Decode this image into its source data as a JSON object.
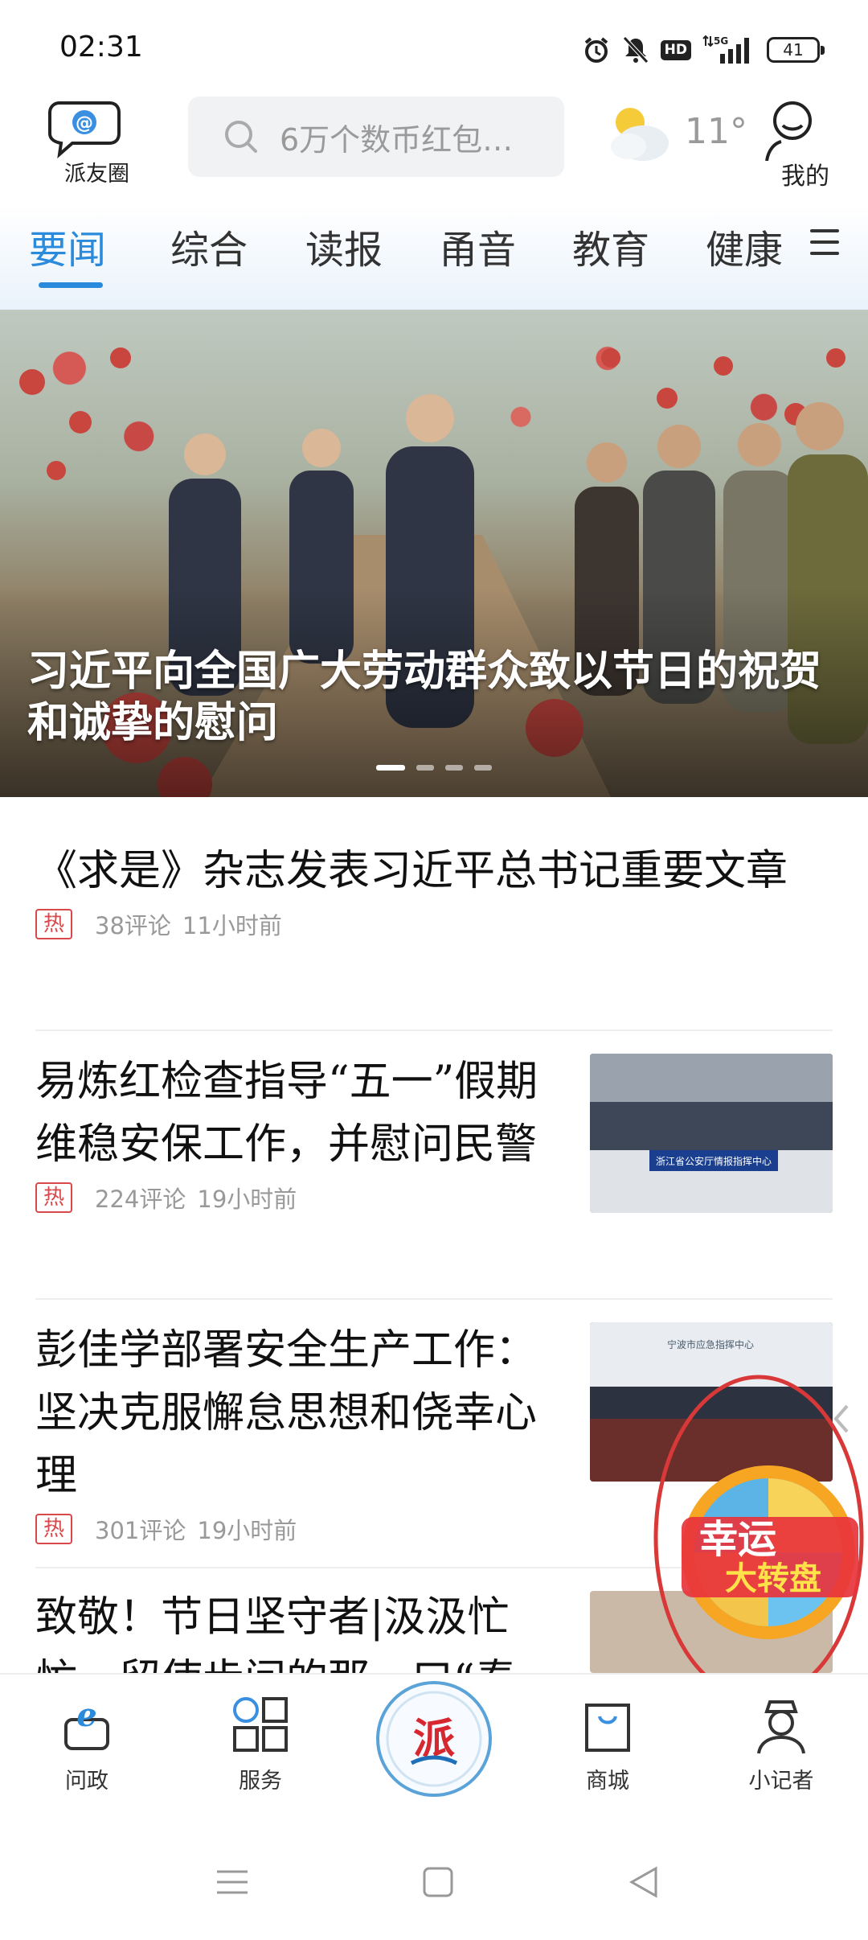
{
  "status_bar": {
    "time": "02:31",
    "hd": "HD",
    "network": "5G",
    "battery": "41"
  },
  "header": {
    "paiyouquan_label": "派友圈",
    "search_placeholder": "6万个数币红包…",
    "temperature": "11°",
    "mine_label": "我的"
  },
  "tabs": [
    {
      "label": "要闻",
      "active": true
    },
    {
      "label": "综合"
    },
    {
      "label": "读报"
    },
    {
      "label": "甬音"
    },
    {
      "label": "教育"
    },
    {
      "label": "健康"
    }
  ],
  "banner": {
    "title": "习近平向全国广大劳动群众致以节日的祝贺和诚挚的慰问",
    "slides": 4,
    "active_slide": 1
  },
  "news": [
    {
      "title": "《求是》杂志发表习近平总书记重要文章",
      "hot": "热",
      "comments": "38评论",
      "time": "11小时前"
    },
    {
      "title": "易炼红检查指导“五一”假期维稳安保工作，并慰问民警",
      "hot": "热",
      "comments": "224评论",
      "time": "19小时前",
      "thumb_caption": "浙江省公安厅情报指挥中心"
    },
    {
      "title": "彭佳学部署安全生产工作：坚决克服懈怠思想和侥幸心理",
      "hot": "热",
      "comments": "301评论",
      "time": "19小时前",
      "thumb_caption": "宁波市应急指挥中心"
    },
    {
      "title": "致敬！节日坚守者|汲汲忙忙，留使步间的那一口“奉"
    }
  ],
  "lucky_wheel": {
    "line1": "幸运",
    "line2": "大转盘"
  },
  "bottom_nav": [
    {
      "label": "问政"
    },
    {
      "label": "服务"
    },
    {
      "label": "派",
      "center": true
    },
    {
      "label": "商城"
    },
    {
      "label": "小记者"
    }
  ]
}
